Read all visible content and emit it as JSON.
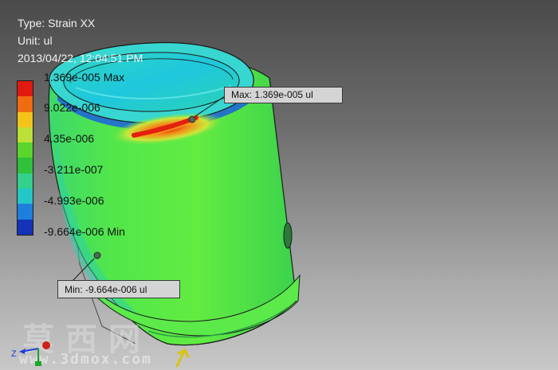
{
  "header": {
    "type_line": "Type: Strain XX",
    "unit_line": "Unit: ul",
    "timestamp": "2013/04/22, 12:04:51 PM"
  },
  "legend": {
    "labels": [
      "1.369e-005 Max",
      "9.022e-006",
      "4.35e-006",
      "-3.211e-007",
      "-4.993e-006",
      "-9.664e-006 Min"
    ],
    "colors": [
      "#e01a0e",
      "#f07a12",
      "#f3c31a",
      "#bde038",
      "#5ad52c",
      "#2fc23a",
      "#33d18c",
      "#24c7c7",
      "#1e7fdc",
      "#1433b8"
    ]
  },
  "probes": {
    "max_label": "Max: 1.369e-005 ul",
    "min_label": "Min: -9.664e-006 ul"
  },
  "triad": {
    "z_label": "Z"
  },
  "watermark": {
    "chinese": "莫西网",
    "url": "www.3dmox.com"
  }
}
